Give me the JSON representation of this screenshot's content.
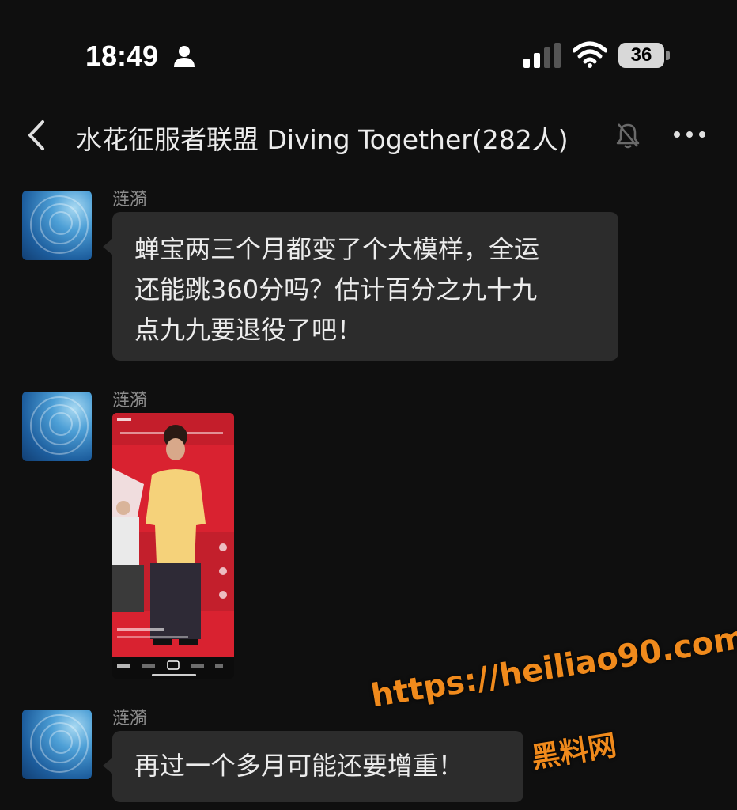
{
  "status_bar": {
    "time": "18:49",
    "battery": "36"
  },
  "header": {
    "title": "水花征服者联盟 Diving Together(282人)"
  },
  "messages": [
    {
      "sender": "涟漪",
      "text_lines": [
        "蝉宝两三个月都变了个大模样，全运",
        "还能跳360分吗？估计百分之九十九",
        "点九九要退役了吧！"
      ]
    },
    {
      "sender": "涟漪",
      "type": "image"
    },
    {
      "sender": "涟漪",
      "text_lines": [
        "再过一个多月可能还要增重！"
      ]
    }
  ],
  "watermark": {
    "url": "https://heiliao90.com",
    "name": "黑料网",
    "color": "#f08a1c"
  },
  "icons": [
    "person-icon",
    "signal-icon",
    "wifi-icon",
    "back-icon",
    "mute-icon",
    "more-icon"
  ]
}
